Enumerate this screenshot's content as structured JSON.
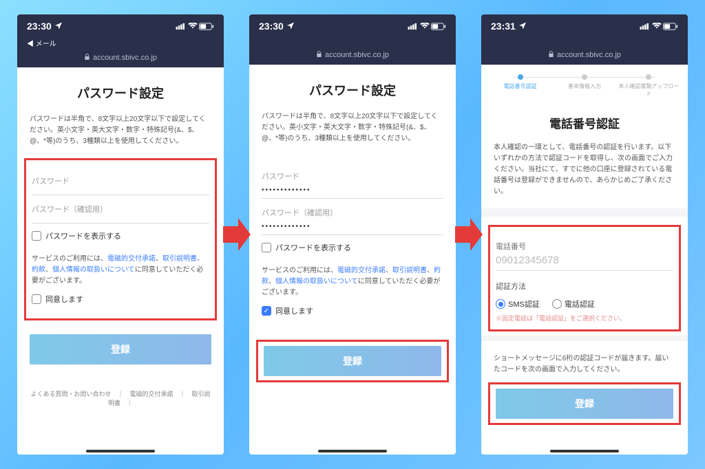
{
  "status": {
    "time1": "23:30",
    "time2": "23:30",
    "time3": "23:31",
    "back_label": "メール",
    "signal_icons": "••ll ⊕ ▢"
  },
  "url": {
    "domain": "account.sbivc.co.jp"
  },
  "screen1": {
    "title": "パスワード設定",
    "desc": "パスワードは半角で、8文字以上20文字以下で設定してください。英小文字・英大文字・数字・特殊記号(&、$、@、*等)のうち、3種類以上を使用してください。",
    "password_label": "パスワード",
    "confirm_label": "パスワード（確認用）",
    "show_pw": "パスワードを表示する",
    "terms_prefix": "サービスのご利用には、",
    "link1": "電磁的交付承諾",
    "link2": "取引説明書",
    "link3": "約款",
    "link4": "個人情報の取扱いについて",
    "terms_suffix": "に同意していただく必要がございます。",
    "agree": "同意します",
    "submit": "登録",
    "footer": "よくある質問・お問い合わせ　｜　電磁的交付承諾　｜　取引説明書　｜"
  },
  "screen2": {
    "title": "パスワード設定",
    "desc": "パスワードは半角で、8文字以上20文字以下で設定してください。英小文字・英大文字・数字・特殊記号(&、$、@、*等)のうち、3種類以上を使用してください。",
    "password_label": "パスワード",
    "password_value": "•••••••••••••",
    "confirm_label": "パスワード（確認用）",
    "confirm_value": "•••••••••••••",
    "show_pw": "パスワードを表示する",
    "terms_prefix": "サービスのご利用には、",
    "link1": "電磁的交付承諾",
    "link2": "取引説明書",
    "link3": "約款",
    "link4": "個人情報の取扱いについて",
    "terms_suffix": "に同意していただく必要がございます。",
    "agree": "同意します",
    "submit": "登録"
  },
  "screen3": {
    "step1": "電話番号認証",
    "step2": "基本情報入力",
    "step3": "本人確認書類アップロード",
    "title": "電話番号認証",
    "desc": "本人確認の一環として、電話番号の認証を行います。以下いずれかの方法で認証コードを取得し、次の画面でご入力ください。当社にて、すでに他の口座に登録されている電話番号は登録ができませんので、あらかじめご了承ください。",
    "phone_label": "電話番号",
    "phone_placeholder": "09012345678",
    "method_label": "認証方法",
    "radio_sms": "SMS認証",
    "radio_call": "電話認証",
    "note": "※固定電話は「電話認証」をご選択ください。",
    "extra": "ショートメッセージに6桁の認証コードが届きます。届いたコードを次の画面で入力してください。",
    "submit": "登録"
  }
}
